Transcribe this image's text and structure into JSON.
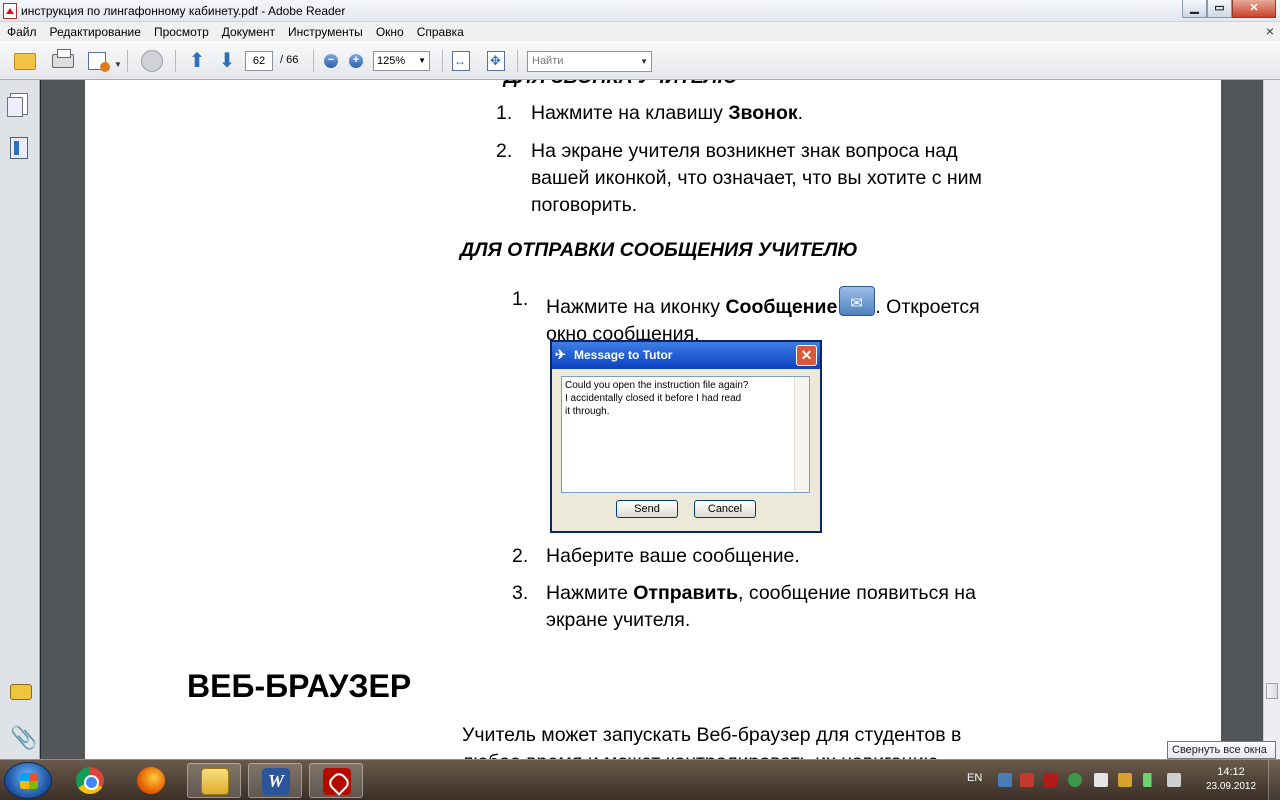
{
  "window": {
    "title": "инструкция по лингафонному кабинету.pdf - Adobe Reader",
    "buttons": {
      "minimize": "▁",
      "maximize": "▭",
      "close": "✕"
    }
  },
  "menu": {
    "items": [
      "Файл",
      "Редактирование",
      "Просмотр",
      "Документ",
      "Инструменты",
      "Окно",
      "Справка"
    ],
    "close_glyph": "×"
  },
  "toolbar": {
    "current_page": "62",
    "total_pages": "/ 66",
    "zoom_out": "−",
    "zoom_in": "+",
    "zoom": "125%",
    "find_placeholder": "Найти",
    "arrow_up": "⬆",
    "arrow_down": "⬇"
  },
  "document": {
    "clipped_heading": "ДЛЯ ЗВОНКА УЧИТЕЛЮ",
    "call_steps": [
      {
        "num": "1.",
        "pre": "Нажмите на клавишу ",
        "bold": "Звонок",
        "post": "."
      },
      {
        "num": "2.",
        "line1": "На экране учителя возникнет знак вопроса над",
        "line2": "вашей иконкой, что означает, что вы хотите с ним",
        "line3": "поговорить."
      }
    ],
    "message_heading": "ДЛЯ ОТПРАВКИ СООБЩЕНИЯ УЧИТЕЛЮ",
    "msg_steps": [
      {
        "num": "1.",
        "pre": "Нажмите на иконку ",
        "bold": "Сообщение",
        "post": ". Откроется",
        "line2": "окно сообщения."
      },
      {
        "num": "2.",
        "text": "Наберите ваше сообщение."
      },
      {
        "num": "3.",
        "pre": "Нажмите ",
        "bold": "Отправить",
        "post": ", сообщение появиться на",
        "line2": "экране учителя."
      }
    ],
    "dialog": {
      "title": "Message to Tutor",
      "text": "Could you open the instruction file again?\nI accidentally closed it before I had read\nit through.",
      "send": "Send",
      "cancel": "Cancel"
    },
    "web_heading": "ВЕБ-БРАУЗЕР",
    "web_line1": "Учитель может запускать Веб-браузер для студентов в",
    "web_line2": "любое время и может контролировать их навигацию"
  },
  "taskbar": {
    "language": "EN",
    "time": "14:12",
    "date": "23.09.2012",
    "word_letter": "W"
  },
  "tooltip": "Свернуть все окна",
  "colors": {
    "accent": "#2f6fb8",
    "xp_title": "#0a3fc0",
    "reader_red": "#b30b00"
  }
}
